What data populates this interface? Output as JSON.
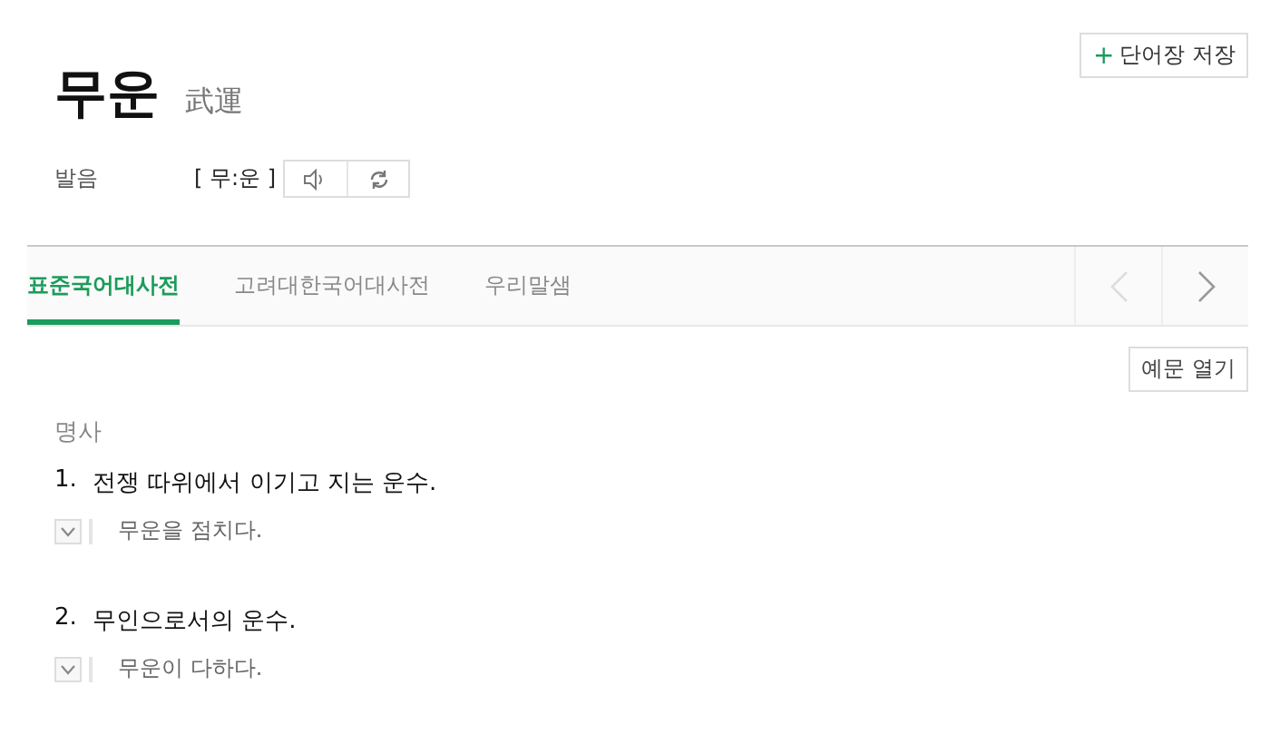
{
  "entry": {
    "word": "무운",
    "hanja": "武運"
  },
  "save_button": {
    "icon": "+",
    "label": "단어장 저장"
  },
  "pronunciation": {
    "label": "발음",
    "value": "[ 무:운 ]"
  },
  "tabs": [
    {
      "label": "표준국어대사전",
      "selected": true
    },
    {
      "label": "고려대한국어대사전",
      "selected": false
    },
    {
      "label": "우리말샘",
      "selected": false
    }
  ],
  "examples_button": "예문 열기",
  "part_of_speech": "명사",
  "senses": [
    {
      "number": "1.",
      "definition": "전쟁 따위에서 이기고 지는 운수.",
      "example": "무운을 점치다.",
      "expanded": false
    },
    {
      "number": "2.",
      "definition": "무인으로서의 운수.",
      "example": "무운이 다하다.",
      "expanded": false
    }
  ]
}
